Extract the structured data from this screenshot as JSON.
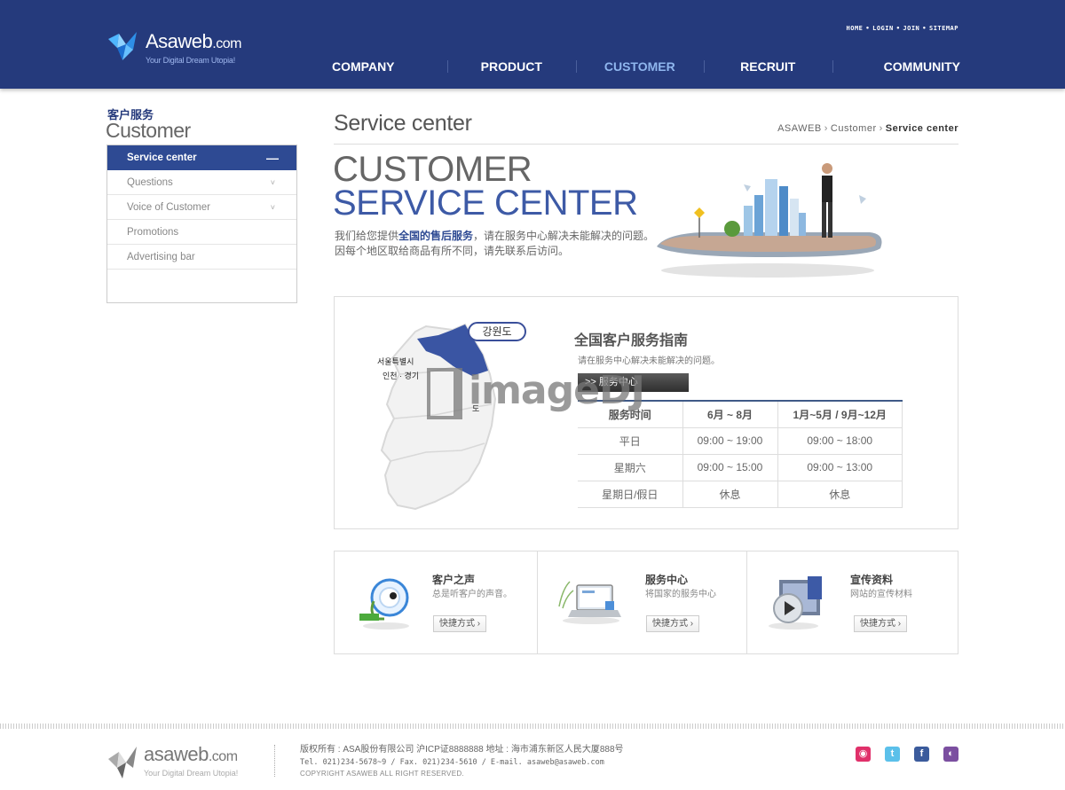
{
  "header": {
    "logo_name": "Asaweb",
    "logo_suffix": ".com",
    "logo_slogan": "Your Digital Dream Utopia!",
    "util": [
      "HOME",
      "LOGIN",
      "JOIN",
      "SITEMAP"
    ],
    "gnb": [
      "COMPANY",
      "PRODUCT",
      "CUSTOMER",
      "RECRUIT",
      "COMMUNITY"
    ],
    "gnb_active": "CUSTOMER",
    "nav_color": "#253a7c"
  },
  "sidebar": {
    "title_cn": "客户服务",
    "title_en": "Customer",
    "items": [
      {
        "label": "Service center"
      },
      {
        "label": "Questions"
      },
      {
        "label": "Voice of Customer"
      },
      {
        "label": "Promotions"
      },
      {
        "label": "Advertising bar"
      }
    ]
  },
  "main": {
    "page_title": "Service center",
    "breadcrumb": [
      "ASAWEB",
      "Customer",
      "Service center"
    ],
    "hero_line1": "CUSTOMER",
    "hero_line2": "SERVICE CENTER",
    "hero_desc1_pre": "我们给您提供",
    "hero_desc1_em": "全国的售后服务",
    "hero_desc1_post": "，请在服务中心解决未能解决的问题。",
    "hero_desc2": "因每个地区取给商品有所不同，请先联系后访问。"
  },
  "guide": {
    "region_badge": "강원도",
    "map_labels": [
      "서울특별시",
      "인천 · 경기",
      "도"
    ],
    "title": "全国客户服务指南",
    "subtitle": "请在服务中心解决未能解决的问题。",
    "button": ">>  服务中心",
    "watermark": "imageDJ",
    "table": {
      "headers": [
        "服务时间",
        "6月 ~ 8月",
        "1月~5月 / 9月~12月"
      ],
      "rows": [
        [
          "平日",
          "09:00 ~ 19:00",
          "09:00 ~ 18:00"
        ],
        [
          "星期六",
          "09:00 ~ 15:00",
          "09:00 ~ 13:00"
        ],
        [
          "星期日/假日",
          "休息",
          "休息"
        ]
      ]
    }
  },
  "quick": [
    {
      "title": "客户之声",
      "desc": "总是听客户的声音。",
      "btn": "快捷方式 ›",
      "icon": "headset-icon"
    },
    {
      "title": "服务中心",
      "desc": "将国家的服务中心",
      "btn": "快捷方式 ›",
      "icon": "laptop-icon"
    },
    {
      "title": "宣传资料",
      "desc": "网站的宣传材料",
      "btn": "快捷方式 ›",
      "icon": "video-icon"
    }
  ],
  "footer": {
    "logo_name": "asaweb",
    "logo_suffix": ".com",
    "logo_slogan": "Your Digital Dream Utopia!",
    "line1": "版权所有 : ASA股份有限公司 沪ICP证8888888    地址 : 海市浦东新区人民大厦888号",
    "line2": "Tel. 021)234-5678~9  / Fax. 021)234-5610  / E-mail. asaweb@asaweb.com",
    "line3": "COPYRIGHT ASAWEB ALL RIGHT RESERVED.",
    "sns": [
      "weibo-icon",
      "twitter-icon",
      "facebook-icon",
      "me2day-icon"
    ]
  }
}
